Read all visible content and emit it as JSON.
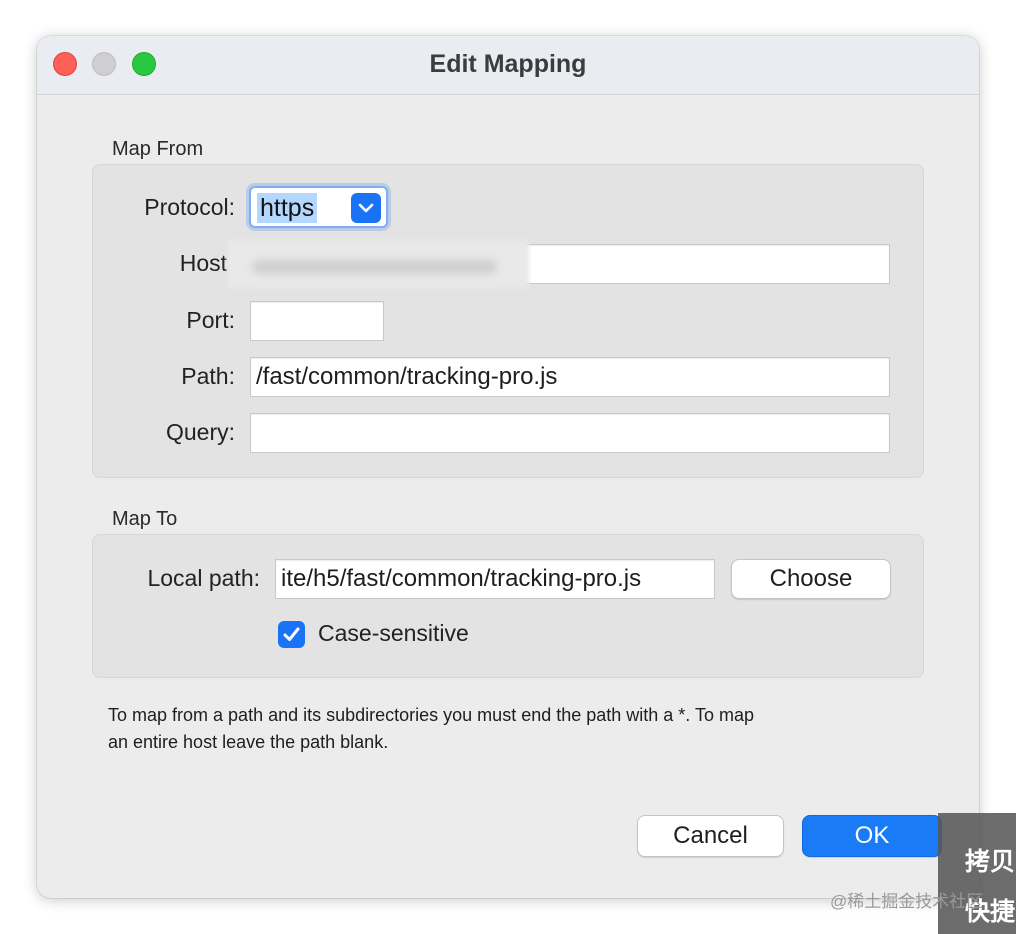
{
  "window": {
    "title": "Edit Mapping"
  },
  "map_from": {
    "section_label": "Map From",
    "protocol": {
      "label": "Protocol:",
      "value": "https"
    },
    "host": {
      "label": "Host"
    },
    "port": {
      "label": "Port:",
      "value": ""
    },
    "path": {
      "label": "Path:",
      "value": "/fast/common/tracking-pro.js"
    },
    "query": {
      "label": "Query:",
      "value": ""
    }
  },
  "map_to": {
    "section_label": "Map To",
    "local_path": {
      "label": "Local path:",
      "value": "ite/h5/fast/common/tracking-pro.js"
    },
    "choose_label": "Choose",
    "case_sensitive": {
      "label": "Case-sensitive",
      "checked": true
    }
  },
  "hint": {
    "line1": "To map from a path and its subdirectories you must end the path with a *. To map",
    "line2": "an entire host leave the path blank."
  },
  "buttons": {
    "cancel": "Cancel",
    "ok": "OK"
  },
  "overlay": {
    "line1": "拷贝",
    "line2": "快捷"
  },
  "watermark": "@稀土掘金技术社区",
  "colors": {
    "accent": "#1a7bf6",
    "window_bg": "#ececec",
    "close": "#fe5f57",
    "zoom": "#29c840"
  }
}
